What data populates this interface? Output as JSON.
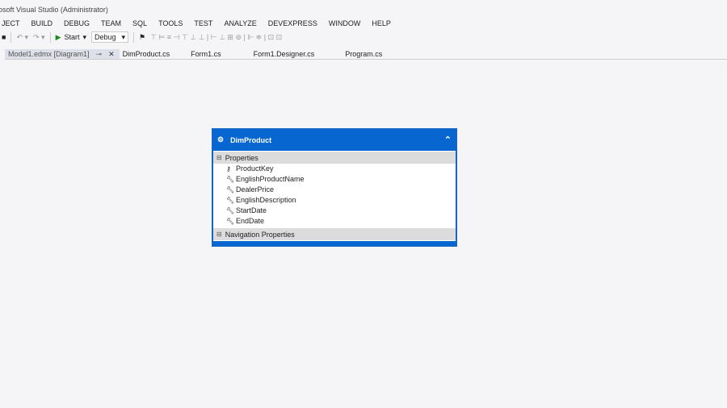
{
  "window": {
    "title": "osoft Visual Studio (Administrator)"
  },
  "menu": [
    "JECT",
    "BUILD",
    "DEBUG",
    "TEAM",
    "SQL",
    "TOOLS",
    "TEST",
    "ANALYZE",
    "DEVEXPRESS",
    "WINDOW",
    "HELP"
  ],
  "toolbar": {
    "start_label": "Start",
    "config": "Debug"
  },
  "tabs": [
    "Model1.edmx [Diagram1]",
    "DimProduct.cs",
    "Form1.cs",
    "Form1.Designer.cs",
    "Program.cs"
  ],
  "entity": {
    "name": "DimProduct",
    "properties_label": "Properties",
    "properties": [
      "ProductKey",
      "EnglishProductName",
      "DealerPrice",
      "EnglishDescription",
      "StartDate",
      "EndDate"
    ],
    "nav_label": "Navigation Properties"
  }
}
